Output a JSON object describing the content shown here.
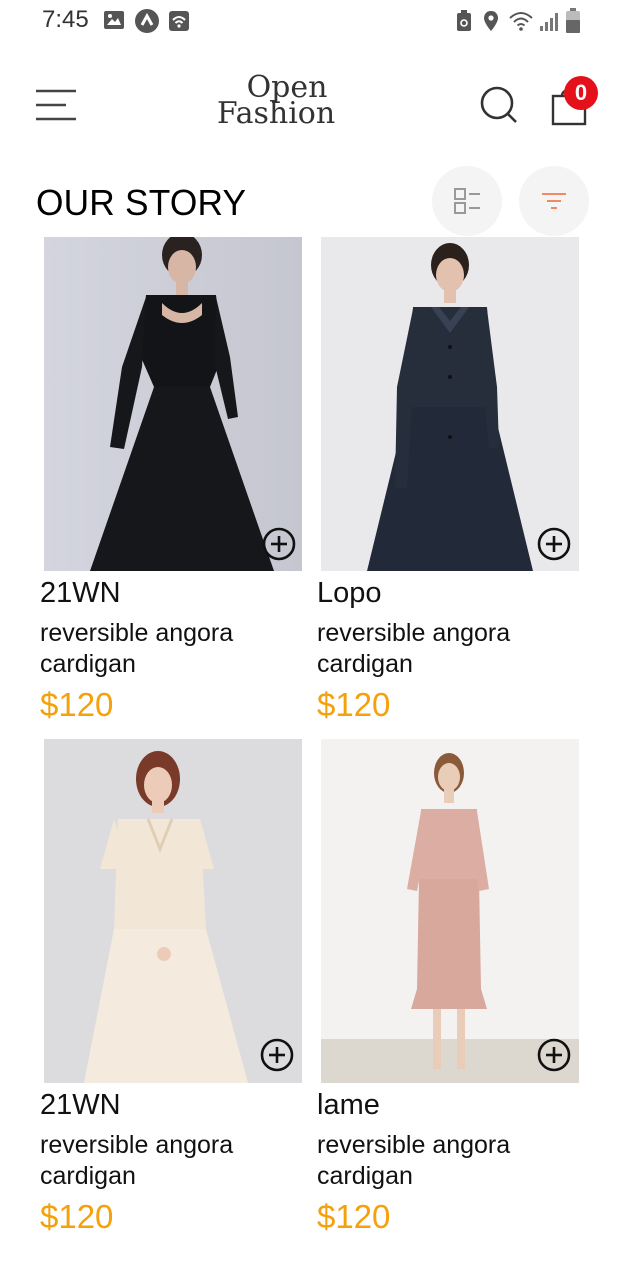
{
  "status_bar": {
    "time": "7:45"
  },
  "header": {
    "logo_line1": "Open",
    "logo_line2": "Fashion",
    "cart_count": "0",
    "icons": [
      "menu-icon",
      "search-icon",
      "shopping-bag-icon"
    ]
  },
  "page": {
    "title": "OUR STORY",
    "view_toggle_icon": "list-view-icon",
    "filter_icon": "filter-icon",
    "accent_color": "#f5a10b"
  },
  "products": [
    {
      "brand": "21WN",
      "name": "reversible angora cardigan",
      "price": "$120"
    },
    {
      "brand": "Lopo",
      "name": "reversible angora cardigan",
      "price": "$120"
    },
    {
      "brand": "21WN",
      "name": "reversible angora cardigan",
      "price": "$120"
    },
    {
      "brand": "lame",
      "name": "reversible angora cardigan",
      "price": "$120"
    }
  ]
}
